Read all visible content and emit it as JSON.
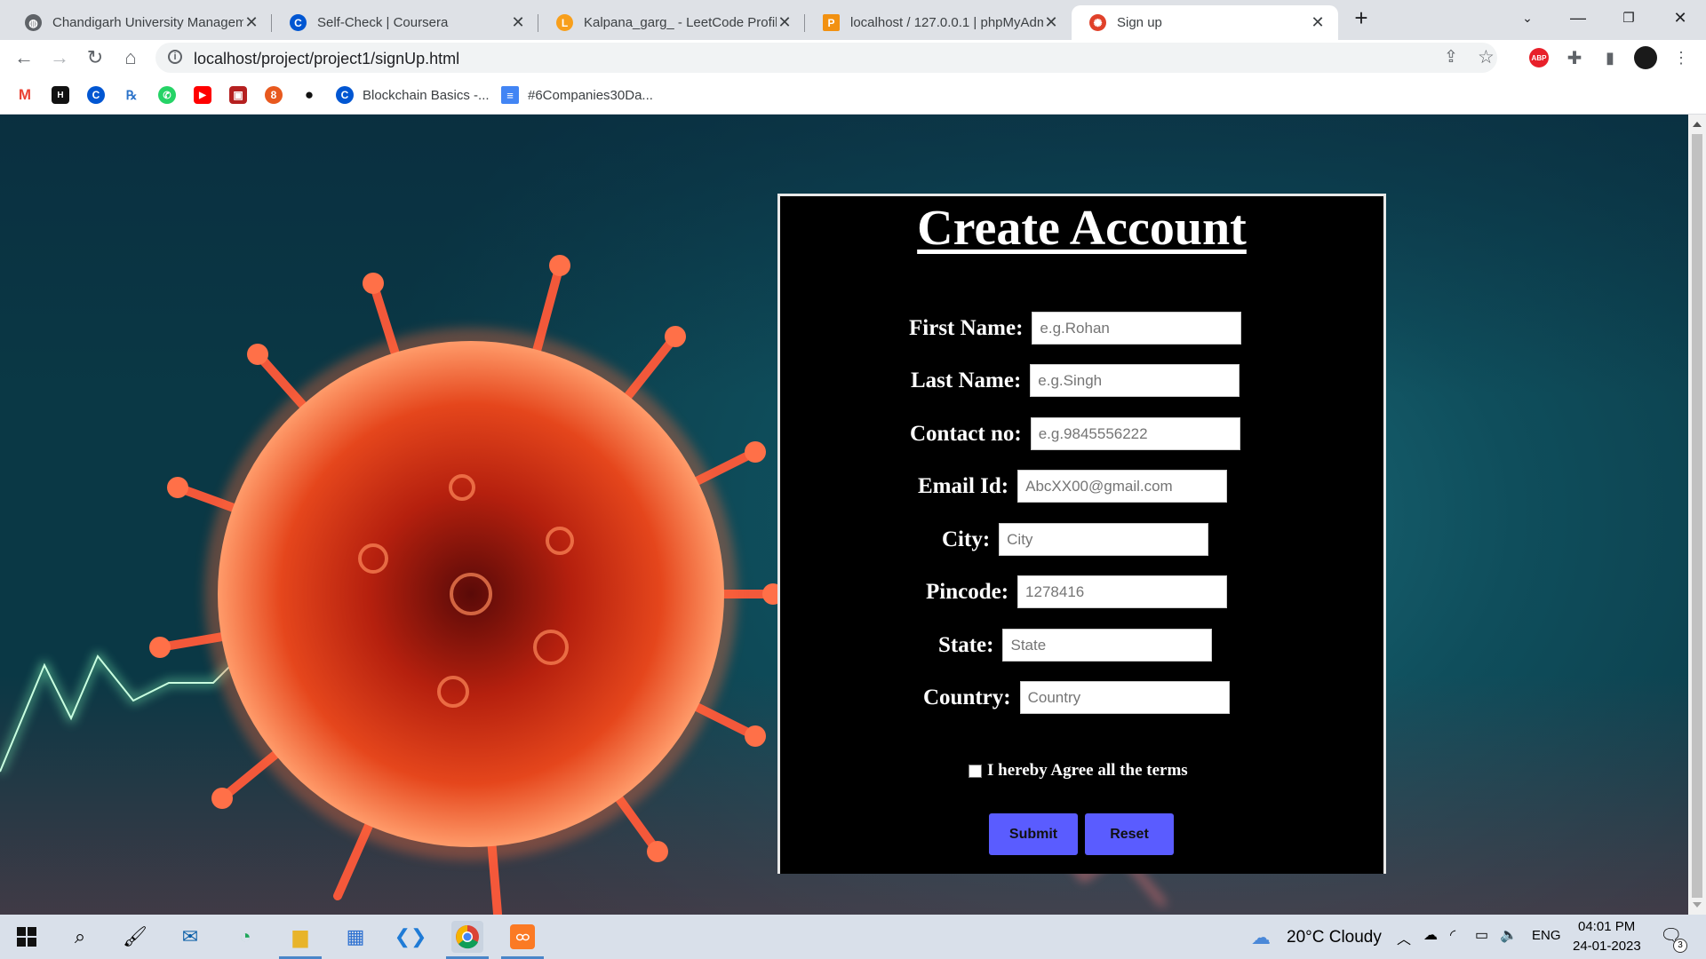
{
  "browser": {
    "tabs": [
      {
        "title": "Chandigarh University Managem",
        "icon": "globe-icon",
        "active": false
      },
      {
        "title": "Self-Check | Coursera",
        "icon": "coursera-icon",
        "active": false
      },
      {
        "title": "Kalpana_garg_ - LeetCode Profile",
        "icon": "leetcode-icon",
        "active": false
      },
      {
        "title": "localhost / 127.0.0.1 | phpMyAdm",
        "icon": "phpmyadmin-icon",
        "active": false
      },
      {
        "title": "Sign up",
        "icon": "virus-favicon",
        "active": true
      }
    ],
    "url": "localhost/project/project1/signUp.html",
    "bookmarks": [
      {
        "label": "",
        "icon": "gmail-icon"
      },
      {
        "label": "",
        "icon": "hackerrank-icon"
      },
      {
        "label": "",
        "icon": "coursera-icon"
      },
      {
        "label": "",
        "icon": "gfg-icon"
      },
      {
        "label": "",
        "icon": "whatsapp-icon"
      },
      {
        "label": "",
        "icon": "youtube-icon"
      },
      {
        "label": "",
        "icon": "app-icon"
      },
      {
        "label": "",
        "icon": "app2-icon"
      },
      {
        "label": "",
        "icon": "github-icon"
      },
      {
        "label": "Blockchain Basics -...",
        "icon": "coursera-icon"
      },
      {
        "label": "#6Companies30Da...",
        "icon": "docs-icon"
      }
    ],
    "extension_badge": "ABP"
  },
  "form": {
    "title": "Create Account",
    "fields": [
      {
        "label": "First Name:",
        "placeholder": "e.g.Rohan"
      },
      {
        "label": "Last Name:",
        "placeholder": "e.g.Singh"
      },
      {
        "label": "Contact no:",
        "placeholder": "e.g.9845556222"
      },
      {
        "label": "Email Id:",
        "placeholder": "AbcXX00@gmail.com"
      },
      {
        "label": "City:",
        "placeholder": "City"
      },
      {
        "label": "Pincode:",
        "placeholder": "1278416"
      },
      {
        "label": "State:",
        "placeholder": "State"
      },
      {
        "label": "Country:",
        "placeholder": "Country"
      }
    ],
    "terms_label": "I hereby Agree all the terms",
    "submit_label": "Submit",
    "reset_label": "Reset",
    "button_color": "#5a5cff"
  },
  "taskbar": {
    "weather": "20°C  Cloudy",
    "language": "ENG",
    "time": "04:01 PM",
    "date": "24-01-2023",
    "notification_count": "3"
  }
}
